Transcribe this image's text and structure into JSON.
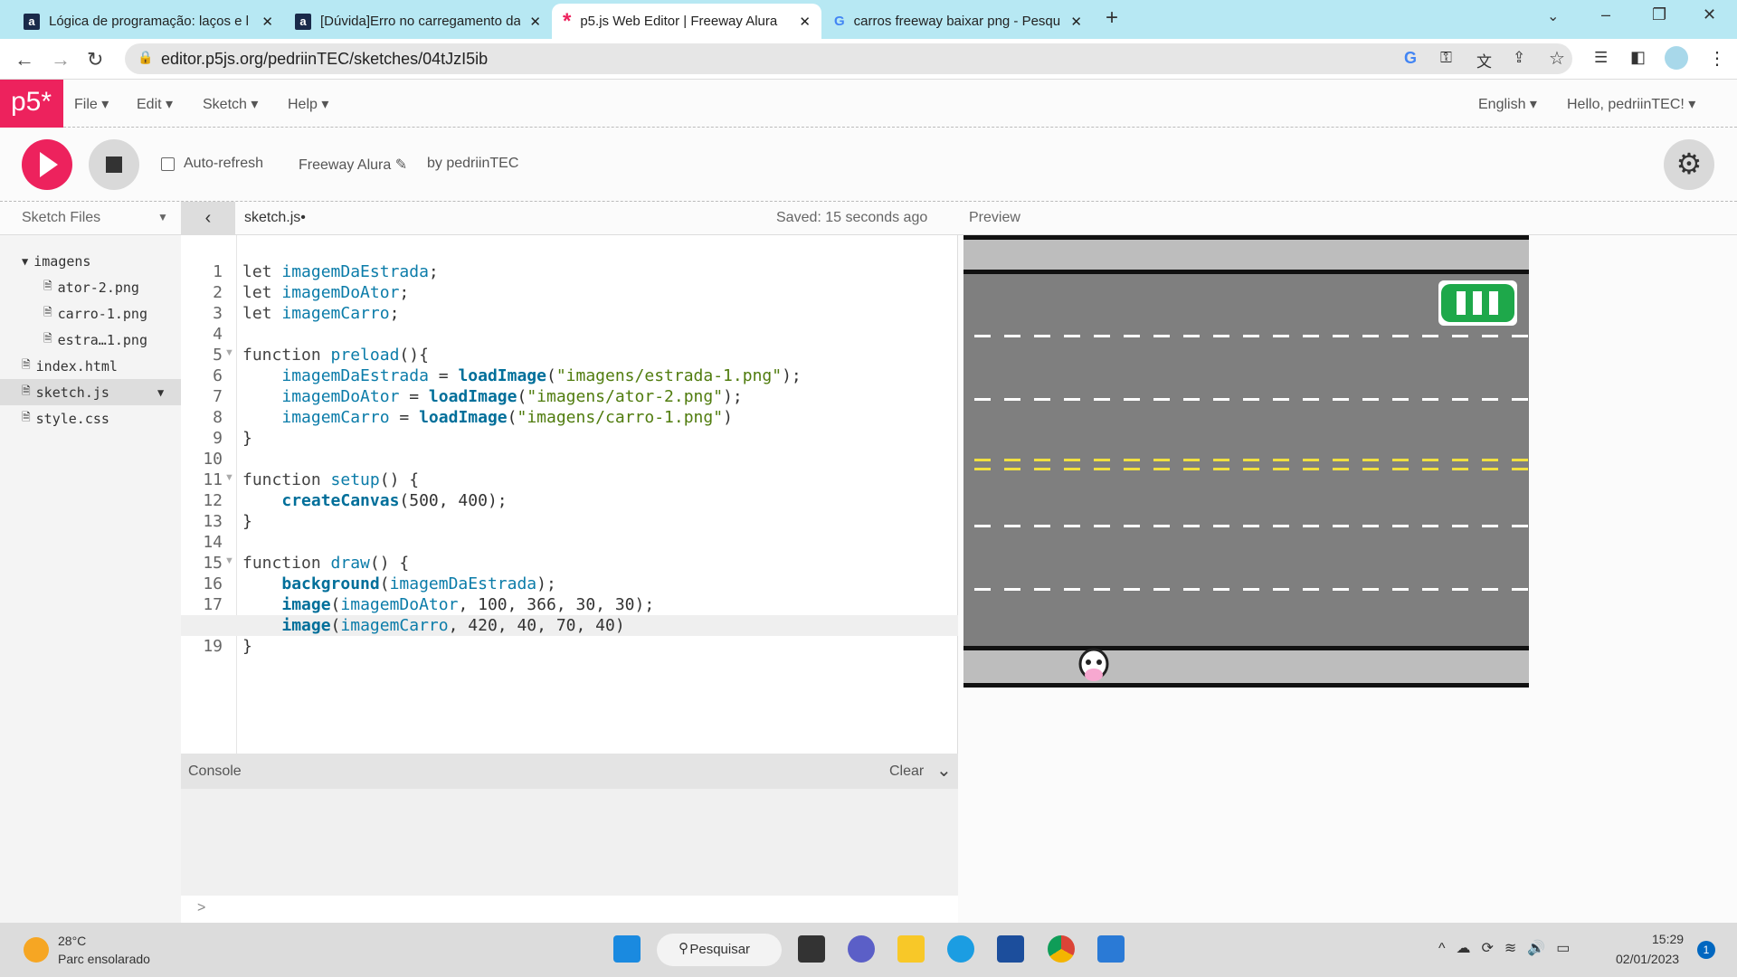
{
  "browser": {
    "tabs": [
      {
        "title": "Lógica de programação: laços e l",
        "icon": "alura-icon"
      },
      {
        "title": "[Dúvida]Erro no carregamento da",
        "icon": "alura-icon"
      },
      {
        "title": "p5.js Web Editor | Freeway Alura",
        "icon": "p5-asterisk-icon"
      },
      {
        "title": "carros freeway baixar png - Pesqu",
        "icon": "google-icon"
      }
    ],
    "url": "editor.p5js.org/pedriinTEC/sketches/04tJzI5ib"
  },
  "menu": {
    "logo": "p5*",
    "items": [
      "File",
      "Edit",
      "Sketch",
      "Help"
    ],
    "language": "English",
    "user": "Hello, pedriinTEC!"
  },
  "toolbar": {
    "auto_refresh": "Auto-refresh",
    "sketch_name": "Freeway Alura",
    "by": "by pedriinTEC",
    "auto_refresh_checked": false
  },
  "files": {
    "header": "Sketch Files",
    "tab": "sketch.js",
    "saved": "Saved: 15 seconds ago",
    "tree": [
      {
        "name": "imagens",
        "type": "folder",
        "depth": 0
      },
      {
        "name": "ator-2.png",
        "type": "file",
        "depth": 1
      },
      {
        "name": "carro-1.png",
        "type": "file",
        "depth": 1
      },
      {
        "name": "estra…1.png",
        "type": "file",
        "depth": 1
      },
      {
        "name": "index.html",
        "type": "file",
        "depth": 0
      },
      {
        "name": "sketch.js",
        "type": "file",
        "depth": 0,
        "selected": true
      },
      {
        "name": "style.css",
        "type": "file",
        "depth": 0
      }
    ]
  },
  "code": [
    "<k>let</k> <v>imagemDaEstrada</v>;",
    "<k>let</k> <v>imagemDoAtor</v>;",
    "<k>let</k> <v>imagemCarro</v>;",
    "",
    "<k>function</k> <v>preload</v>(){",
    "    <v>imagemDaEstrada</v> = <f>loadImage</f>(<s>\"imagens/estrada-1.png\"</s>);",
    "    <v>imagemDoAtor</v> = <f>loadImage</f>(<s>\"imagens/ator-2.png\"</s>);",
    "    <v>imagemCarro</v> = <f>loadImage</f>(<s>\"imagens/carro-1.png\"</s>)",
    "}",
    "",
    "<k>function</k> <v>setup</v>() {",
    "    <f>createCanvas</f>(500, 400);",
    "}",
    "",
    "<k>function</k> <v>draw</v>() {",
    "    <f>background</f>(<v>imagemDaEstrada</v>);",
    "    <f>image</f>(<v>imagemDoAtor</v>, 100, 366, 30, 30);",
    "    <f>image</f>(<v>imagemCarro</v>, 420, 40, 70, 40)",
    "}"
  ],
  "preview": {
    "label": "Preview"
  },
  "console": {
    "label": "Console",
    "clear": "Clear",
    "prompt": ">"
  },
  "taskbar": {
    "temp": "28°C",
    "weather": "Parc ensolarado",
    "search": "Pesquisar",
    "time": "15:29",
    "date": "02/01/2023",
    "notifications": "1"
  }
}
